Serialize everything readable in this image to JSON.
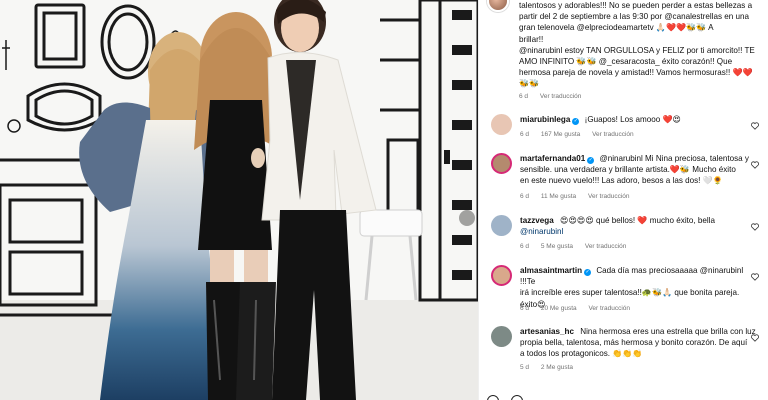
{
  "caption": {
    "lines": [
      "talentosos y adorables!!! No se pueden perder a estas bellezas a",
      "partir del 2 de septiembre a las 9:30 por @canalestrellas en una",
      "gran telenovela @elpreciodeamartetv 🙏🏻❤️❤️🐝🐝 A",
      "brillar!!",
      "@ninarubinl estoy TAN ORGULLOSA y FELIZ por ti amorcito!! TE",
      "AMO INFINITO 🐝🐝 @_cesaracosta_ éxito corazón!! Que",
      "hermosa pareja de novela y amistad!! Vamos hermosuras!! ❤️❤️",
      "🐝🐝"
    ],
    "age": "6 d",
    "translate_label": "Ver traducción"
  },
  "comments": [
    {
      "username": "miarubinlega",
      "verified": true,
      "text": "¡Guapos! Los amooo ❤️😍",
      "age": "6 d",
      "likes": "167 Me gusta",
      "translate_label": "Ver traducción",
      "avatar_color": "#e8c6b4"
    },
    {
      "username": "martafernanda01",
      "verified": true,
      "text_lines": [
        "@ninarubinl Mi Nina preciosa, talentosa y",
        "sensible. una verdadera y brillante artista.❤️🐝 Mucho éxito",
        "en este nuevo vuelo!!! Las adoro, besos a las dos! 🤍🌻"
      ],
      "age": "6 d",
      "likes": "11 Me gusta",
      "translate_label": "Ver traducción",
      "avatar_color": "#b48a6e"
    },
    {
      "username": "tazzvega",
      "verified": false,
      "text_lines": [
        "😍😍😍😍 qué bellos! ❤️ mucho éxito, bella",
        "@ninarubinl"
      ],
      "age": "6 d",
      "likes": "5 Me gusta",
      "translate_label": "Ver traducción",
      "avatar_color": "#9fb3c8"
    },
    {
      "username": "almasaintmartin",
      "verified": true,
      "text_lines": [
        "Cada día mas preciosaaaaa @ninarubinl !!!Te",
        "irá increíble eres super talentosa!!🐢🐝🙏🏻 que bonita pareja.",
        "éxito😍"
      ],
      "age": "6 d",
      "likes": "20 Me gusta",
      "translate_label": "Ver traducción",
      "avatar_color": "#d9a88b"
    },
    {
      "username": "artesanias_hc",
      "verified": false,
      "text_lines": [
        "Nina hermosa eres una estrella que brilla con luz",
        "propia bella, talentosa, más hermosa y bonito corazón. De aquí",
        "a todos los protagonicos. 👏👏👏"
      ],
      "age": "5 d",
      "likes": "2 Me gusta",
      "translate_label": "",
      "avatar_color": "#7d8a86"
    }
  ]
}
